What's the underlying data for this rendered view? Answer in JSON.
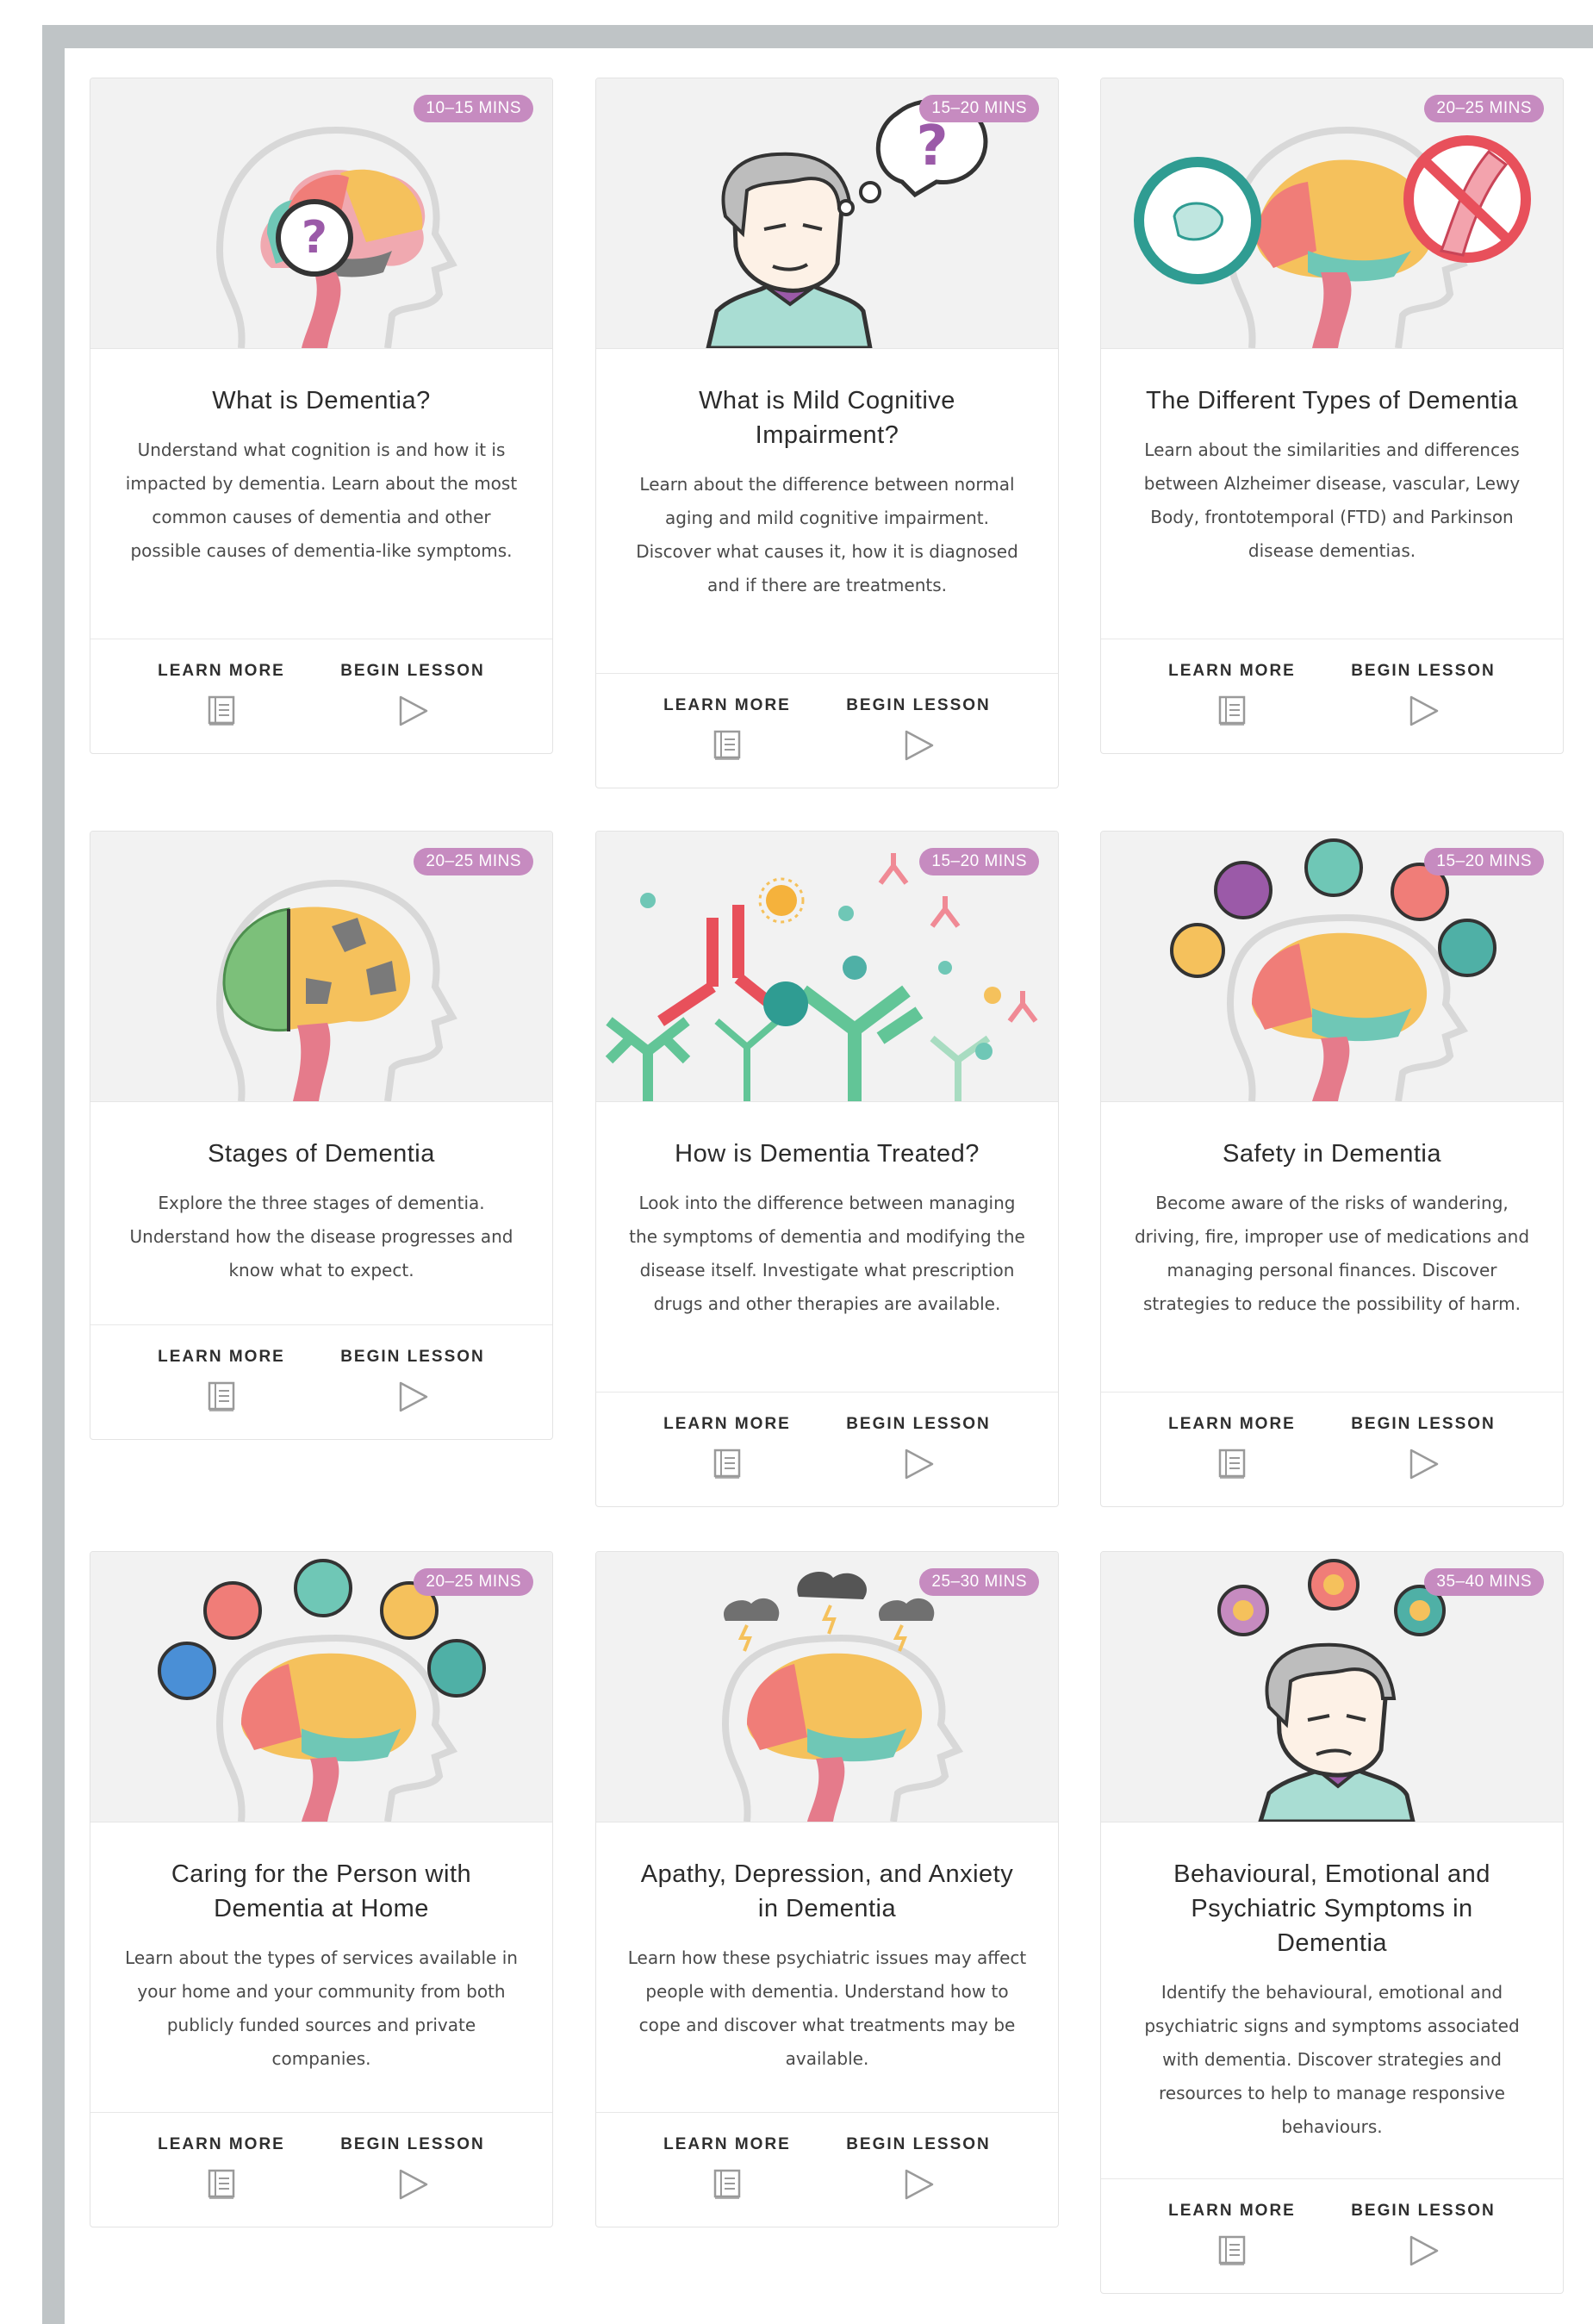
{
  "cards": [
    {
      "duration": "10–15 MINS",
      "title": "What is Dementia?",
      "desc": "Understand what cognition is and how it is impacted by dementia. Learn about the most common causes of dementia and other possible causes of dementia-like symptoms.",
      "learn": "LEARN MORE",
      "begin": "BEGIN LESSON"
    },
    {
      "duration": "15–20 MINS",
      "title": "What is Mild Cognitive Impairment?",
      "desc": "Learn about the difference between normal aging and mild cognitive impairment. Discover what causes it, how it is diagnosed and if there are treatments.",
      "learn": "LEARN MORE",
      "begin": "BEGIN LESSON"
    },
    {
      "duration": "20–25 MINS",
      "title": "The Different Types of Dementia",
      "desc": "Learn about the similarities and differences between Alzheimer disease, vascular, Lewy Body, frontotemporal (FTD) and Parkinson disease dementias.",
      "learn": "LEARN MORE",
      "begin": "BEGIN LESSON"
    },
    {
      "duration": "20–25 MINS",
      "title": "Stages of Dementia",
      "desc": "Explore the three stages of dementia. Understand how the disease progresses and know what to expect.",
      "learn": "LEARN MORE",
      "begin": "BEGIN LESSON"
    },
    {
      "duration": "15–20 MINS",
      "title": "How is Dementia Treated?",
      "desc": "Look into the difference between managing the symptoms of dementia and modifying the disease itself. Investigate what prescription drugs and other therapies are available.",
      "learn": "LEARN MORE",
      "begin": "BEGIN LESSON"
    },
    {
      "duration": "15–20 MINS",
      "title": "Safety in Dementia",
      "desc": "Become aware of the risks of wandering, driving, fire, improper use of medications and managing personal finances. Discover strategies to reduce the possibility of harm.",
      "learn": "LEARN MORE",
      "begin": "BEGIN LESSON"
    },
    {
      "duration": "20–25 MINS",
      "title": "Caring for the Person with Dementia at Home",
      "desc": "Learn about the types of services available in your home and your community from both publicly funded sources and private companies.",
      "learn": "LEARN MORE",
      "begin": "BEGIN LESSON"
    },
    {
      "duration": "25–30 MINS",
      "title": "Apathy, Depression, and Anxiety in Dementia",
      "desc": "Learn how these psychiatric issues may affect people with dementia. Understand how to cope and discover what treatments may be available.",
      "learn": "LEARN MORE",
      "begin": "BEGIN LESSON"
    },
    {
      "duration": "35–40 MINS",
      "title": "Behavioural, Emotional and Psychiatric Symptoms in Dementia",
      "desc": "Identify the behavioural, emotional and psychiatric signs and symptoms associated with dementia. Discover strategies and resources to help to manage responsive behaviours.",
      "learn": "LEARN MORE",
      "begin": "BEGIN LESSON"
    }
  ],
  "colors": {
    "badge": "#c68bc0",
    "frame": "#bfc4c6"
  },
  "icons": [
    "brain-question-illustration",
    "man-thinking-illustration",
    "brain-types-illustration",
    "brain-stages-illustration",
    "antibodies-illustration",
    "brain-safety-illustration",
    "brain-home-care-illustration",
    "brain-storm-illustration",
    "man-emotions-illustration",
    "book-icon",
    "play-icon"
  ]
}
